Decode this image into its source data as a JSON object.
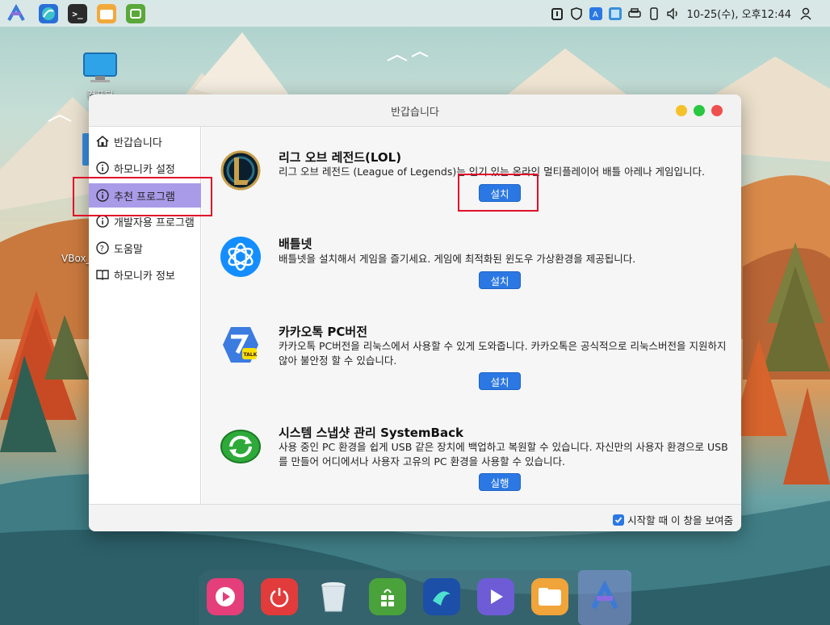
{
  "colors": {
    "accent_blue": "#2b78e4",
    "sidebar_active": "#a99be8",
    "highlight_red": "#e0102a",
    "win_close": "#ef4f4f",
    "win_max": "#28c840",
    "win_min": "#f5c12b"
  },
  "top_panel": {
    "launchers": [
      "app-menu-icon",
      "web-browser-icon",
      "terminal-icon",
      "file-manager-icon",
      "mint-update-icon"
    ],
    "tray_icons": [
      "clipboard-icon",
      "shield-icon",
      "translate-icon",
      "network-icon",
      "printer-icon",
      "phone-icon",
      "volume-icon",
      "user-icon"
    ],
    "clock": "10-25(수), 오후12:44"
  },
  "desktop": {
    "computer_label": "컴퓨터",
    "vbox_label": "VBox_"
  },
  "window": {
    "title": "반갑습니다",
    "sidebar": [
      {
        "label": "반갑습니다",
        "icon": "home-icon"
      },
      {
        "label": "하모니카 설정",
        "icon": "info-icon"
      },
      {
        "label": "추천 프로그램",
        "icon": "info-icon"
      },
      {
        "label": "개발자용 프로그램",
        "icon": "info-icon"
      },
      {
        "label": "도움말",
        "icon": "help-icon"
      },
      {
        "label": "하모니카 정보",
        "icon": "book-icon"
      }
    ],
    "programs": [
      {
        "title": "리그 오브 레전드(LOL)",
        "desc": "리그 오브 레전드 (League of Legends)는 인기 있는 온라인 멀티플레이어 배틀 아레나 게임입니다.",
        "button": "설치"
      },
      {
        "title": "배틀넷",
        "desc": "배틀넷을 설치해서 게임을 즐기세요. 게임에 최적화된 윈도우 가상환경을 제공됩니다.",
        "button": "설치"
      },
      {
        "title": "카카오톡 PC버전",
        "desc": "카카오톡 PC버전을 리눅스에서 사용할 수 있게 도와줍니다. 카카오톡은 공식적으로 리눅스버전을 지원하지 않아 불안정 할 수 있습니다.",
        "button": "설치"
      },
      {
        "title": "시스템 스냅샷 관리 SystemBack",
        "desc": "사용 중인 PC 환경을 쉽게 USB 같은 장치에 백업하고 복원할 수 있습니다. 자신만의 사용자 환경으로 USB를 만들어 어디에서나 사용자 고유의 PC 환경을 사용할 수 있습니다.",
        "button": "실행"
      }
    ],
    "kakao_badge": "TALK",
    "footer_checkbox": "시작할 때 이 창을 보여줌",
    "footer_checked": true
  },
  "dock": {
    "items": [
      "media-player-icon",
      "power-icon",
      "trash-icon",
      "app-store-icon",
      "web-browser-icon",
      "video-player-icon",
      "file-manager-icon",
      "harmonica-icon"
    ]
  }
}
